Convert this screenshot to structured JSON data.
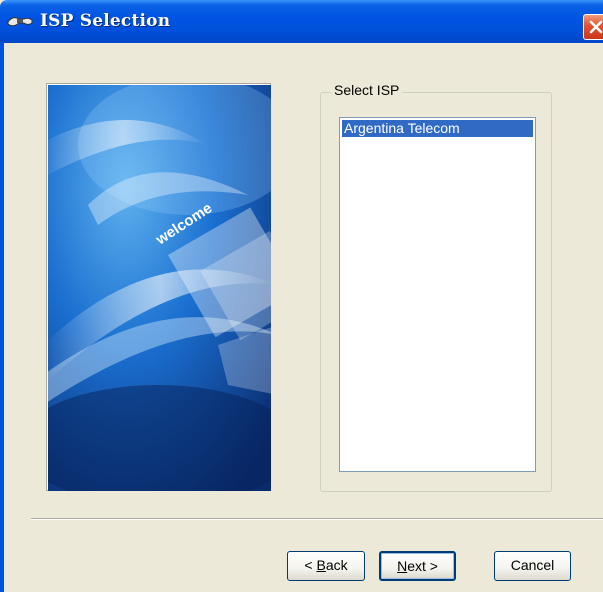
{
  "window": {
    "title": "ISP Selection",
    "icon": "network-cable-icon",
    "close_icon": "close-icon"
  },
  "welcome_image": {
    "text": "welcome",
    "colors": {
      "dark": "#0a2a6e",
      "mid": "#0f5fc2",
      "light": "#5fb2ee"
    }
  },
  "isp_group": {
    "label": "Select ISP",
    "items": [
      {
        "label": "Argentina Telecom",
        "selected": true
      }
    ]
  },
  "buttons": {
    "back": {
      "prefix": "< ",
      "accel": "B",
      "rest": "ack"
    },
    "next": {
      "accel": "N",
      "rest": "ext >"
    },
    "cancel": "Cancel"
  },
  "colors": {
    "titlebar": "#0054e3",
    "dialog_bg": "#ece9d8",
    "selection": "#316ac5",
    "close_button": "#e2522f"
  }
}
